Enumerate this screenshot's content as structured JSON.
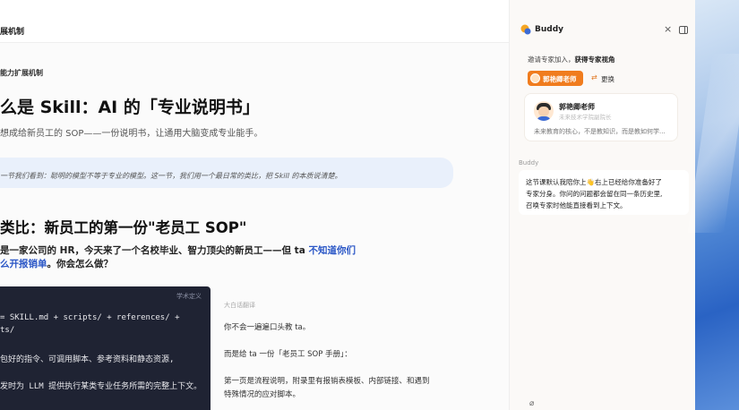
{
  "topbar": {
    "title": "展机制"
  },
  "doc": {
    "section_label": "能力扩展机制",
    "title": "么是 Skill：AI 的「专业说明书」",
    "subtitle": "想成给新员工的 SOP——一份说明书，让通用大脑变成专业能手。",
    "highlight": "一节我们看到：聪明的模型不等于专业的模型。这一节，我们用一个最日常的类比，把 Skill 的本质说清楚。",
    "h2": "类比：新员工的第一份\"老员工 SOP\"",
    "para_line1_pre": "是一家公司的 HR，今天来了一个名校毕业、智力顶尖的新员工——但 ta ",
    "para_line1_link": "不知道你们",
    "para_line2_link": "么开报销单",
    "para_line2_post": "。你会怎么做？",
    "code": {
      "header": "学术定义",
      "line1": "= SKILL.md + scripts/ + references/ +",
      "line2": "ts/",
      "line3": "包好的指令、可调用脚本、参考资料和静态资源,",
      "line4": "发时为 LLM 提供执行某类专业任务所需的完整上下文。"
    },
    "notes": {
      "label": "大白话翻译",
      "line1": "你不会一遍遍口头教 ta。",
      "line2": "而是给 ta 一份「老员工 SOP 手册」：",
      "line3": "第一页是流程说明，附录里有报销表模板、内部链接、和遇到",
      "line4": "特殊情况的应对脚本。"
    }
  },
  "panel": {
    "title": "Buddy",
    "invite_pre": "邀请专家加入，",
    "invite_bold": "获得专家视角",
    "expert_chip": "郭艳卿老师",
    "swap_label": "更换",
    "expert": {
      "name": "郭艳卿老师",
      "role": "未来技术学院副院长",
      "quote": "未来教育的核心，不是教知识，而是教如何学..."
    },
    "buddy_label": "Buddy",
    "message": {
      "line1_pre": "这节课默认我陪你上",
      "line1_emoji": "👋",
      "line1_post": "右上已经给你准备好了",
      "line2": "专家分身。你问的问题都会留在同一条历史里,",
      "line3": "召唤专家时他能直接看到上下文。"
    }
  },
  "icons": {
    "close": "close-icon",
    "layout": "sidebar-toggle-icon",
    "swap": "swap-icon",
    "attach": "paperclip-icon"
  },
  "colors": {
    "accent": "#f07c1e",
    "link": "#2a56c6",
    "code_bg": "#1f2333"
  }
}
